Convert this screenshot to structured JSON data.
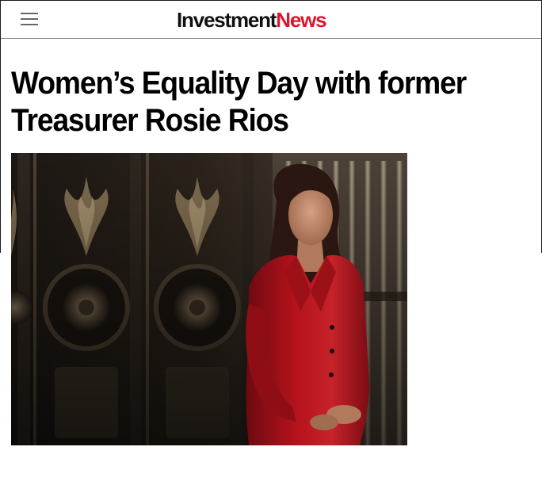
{
  "header": {
    "menu_icon": "hamburger-menu-icon",
    "logo_part1": "Investment",
    "logo_part2": "News",
    "logo_part2_color": "#e0142c"
  },
  "article": {
    "title": "Women’s Equality Day with former Treasurer Rosie Rios",
    "image": {
      "subject": "portrait-photo",
      "accent_color": "#b5121b"
    }
  }
}
